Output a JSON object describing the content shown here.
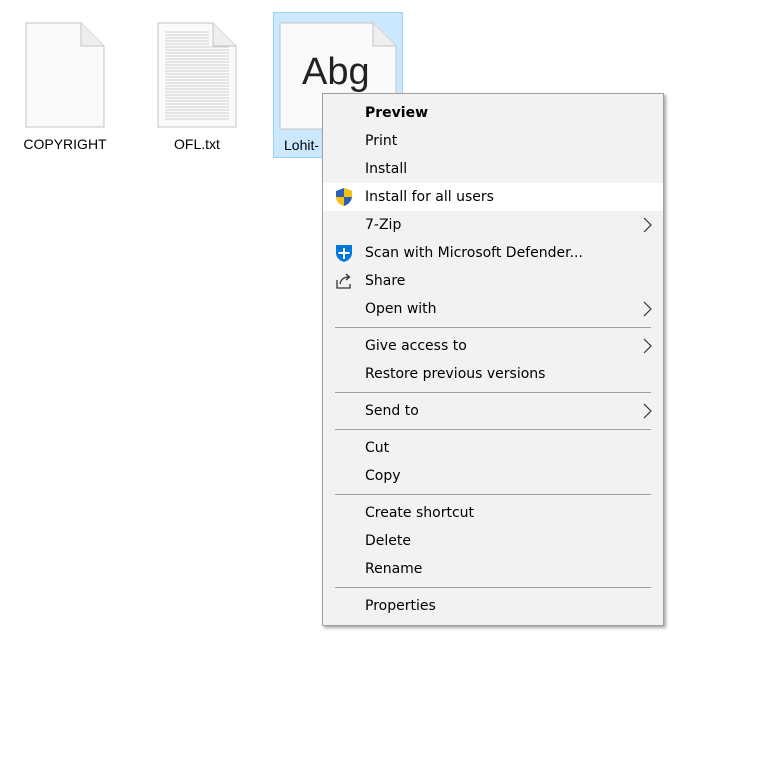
{
  "files": [
    {
      "name": "COPYRIGHT",
      "icon": "blank-document-icon"
    },
    {
      "name": "OFL.txt",
      "icon": "text-document-icon"
    },
    {
      "name": "Lohit-",
      "icon": "font-file-icon",
      "preview_text": "Abg",
      "selected": true
    }
  ],
  "menu": {
    "items": [
      {
        "label": "Preview"
      },
      {
        "label": "Print"
      },
      {
        "label": "Install"
      },
      {
        "label": "Install for all users",
        "icon": "uac-shield-icon"
      },
      {
        "label": "7-Zip",
        "submenu": true
      },
      {
        "label": "Scan with Microsoft Defender...",
        "icon": "defender-shield-icon"
      },
      {
        "label": "Share",
        "icon": "share-icon"
      },
      {
        "label": "Open with",
        "submenu": true
      },
      {
        "label": "Give access to",
        "submenu": true
      },
      {
        "label": "Restore previous versions"
      },
      {
        "label": "Send to",
        "submenu": true
      },
      {
        "label": "Cut"
      },
      {
        "label": "Copy"
      },
      {
        "label": "Create shortcut"
      },
      {
        "label": "Delete"
      },
      {
        "label": "Rename"
      },
      {
        "label": "Properties"
      }
    ]
  },
  "colors": {
    "selection_bg": "#cce8ff",
    "selection_border": "#99d1ff",
    "menu_bg": "#f2f2f2",
    "menu_hover": "#ffffff",
    "defender_blue": "#0078d7",
    "uac_blue": "#2b5fb4",
    "uac_yellow": "#f5c211"
  }
}
